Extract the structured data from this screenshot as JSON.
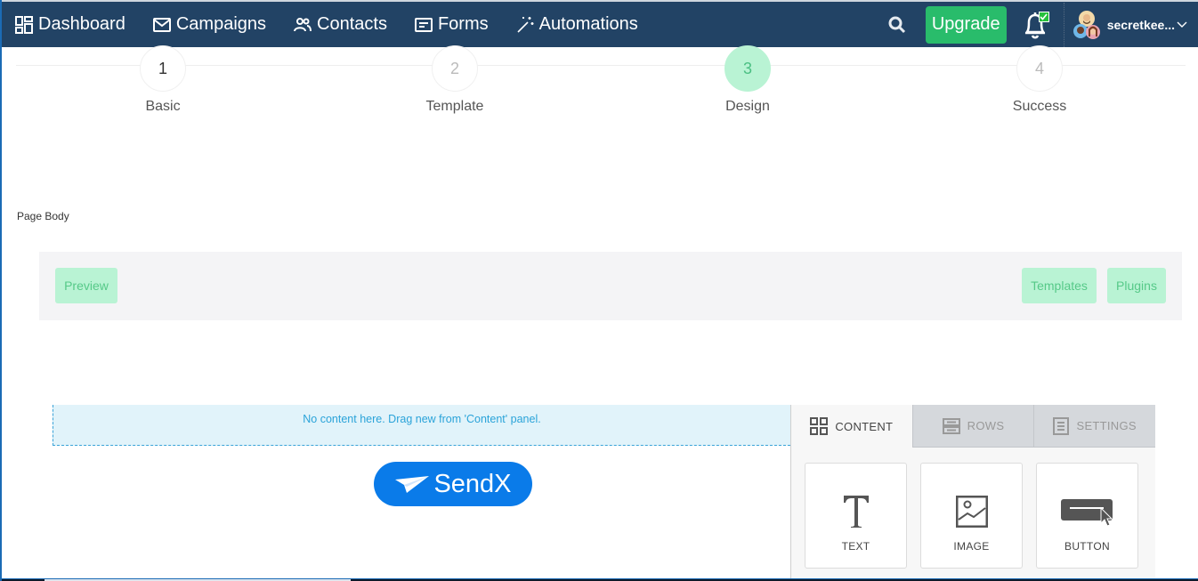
{
  "nav": {
    "items": [
      {
        "label": "Dashboard",
        "icon": "dashboard-icon"
      },
      {
        "label": "Campaigns",
        "icon": "envelope-icon"
      },
      {
        "label": "Contacts",
        "icon": "contacts-icon"
      },
      {
        "label": "Forms",
        "icon": "form-icon"
      },
      {
        "label": "Automations",
        "icon": "magic-wand-icon"
      }
    ],
    "upgrade_label": "Upgrade",
    "username": "secretkee...",
    "colors": {
      "nav_bg": "#224365",
      "upgrade": "#29bc6b"
    }
  },
  "stepper": {
    "steps": [
      {
        "number": "1",
        "label": "Basic",
        "state": "done"
      },
      {
        "number": "2",
        "label": "Template",
        "state": "pending"
      },
      {
        "number": "3",
        "label": "Design",
        "state": "active"
      },
      {
        "number": "4",
        "label": "Success",
        "state": "pending"
      }
    ]
  },
  "page_body_label": "Page Body",
  "toolbar": {
    "preview_label": "Preview",
    "templates_label": "Templates",
    "plugins_label": "Plugins"
  },
  "editor": {
    "empty_message": "No content here. Drag new from 'Content' panel.",
    "logo_text": "SendX"
  },
  "panel": {
    "tabs": [
      {
        "label": "CONTENT",
        "icon": "grid-icon",
        "active": true
      },
      {
        "label": "ROWS",
        "icon": "rows-icon",
        "active": false
      },
      {
        "label": "SETTINGS",
        "icon": "settings-doc-icon",
        "active": false
      }
    ],
    "blocks": [
      {
        "label": "TEXT",
        "icon": "text-icon"
      },
      {
        "label": "IMAGE",
        "icon": "image-icon"
      },
      {
        "label": "BUTTON",
        "icon": "button-icon"
      }
    ]
  }
}
